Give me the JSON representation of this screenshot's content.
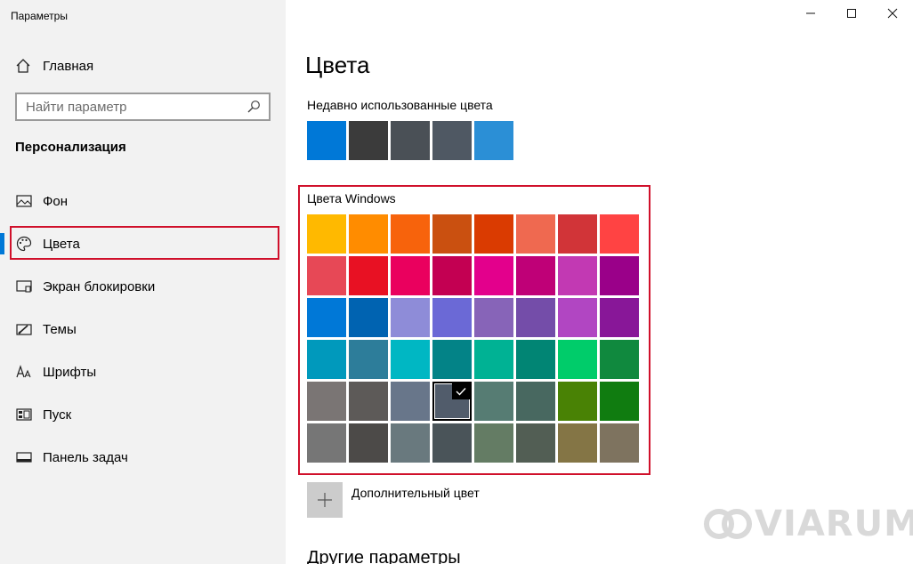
{
  "window": {
    "title": "Параметры"
  },
  "sidebar": {
    "home_label": "Главная",
    "search_placeholder": "Найти параметр",
    "section_title": "Персонализация",
    "items": [
      {
        "label": "Фон",
        "icon": "image-icon"
      },
      {
        "label": "Цвета",
        "icon": "palette-icon",
        "active": true
      },
      {
        "label": "Экран блокировки",
        "icon": "lock-screen-icon"
      },
      {
        "label": "Темы",
        "icon": "themes-icon"
      },
      {
        "label": "Шрифты",
        "icon": "fonts-icon"
      },
      {
        "label": "Пуск",
        "icon": "start-icon"
      },
      {
        "label": "Панель задач",
        "icon": "taskbar-icon"
      }
    ]
  },
  "main": {
    "title": "Цвета",
    "recent_label": "Недавно использованные цвета",
    "recent_colors": [
      "#0078d7",
      "#3b3b3b",
      "#4a5056",
      "#4f5863",
      "#2b8fd6"
    ],
    "windows_colors_label": "Цвета Windows",
    "windows_colors": [
      "#ffb900",
      "#ff8c00",
      "#f7630c",
      "#ca5010",
      "#da3b01",
      "#ef6950",
      "#d13438",
      "#ff4343",
      "#e74856",
      "#e81123",
      "#ea005e",
      "#c30052",
      "#e3008c",
      "#bf0077",
      "#c239b3",
      "#9a0089",
      "#0078d7",
      "#0063b1",
      "#8e8cd8",
      "#6b69d6",
      "#8764b8",
      "#744da9",
      "#b146c2",
      "#881798",
      "#0099bc",
      "#2d7d9a",
      "#00b7c3",
      "#038387",
      "#00b294",
      "#018574",
      "#00cc6a",
      "#10893e",
      "#7a7574",
      "#5d5a58",
      "#68768a",
      "#515c6b",
      "#567c73",
      "#486860",
      "#498205",
      "#107c10",
      "#767676",
      "#4c4a48",
      "#69797e",
      "#4a5459",
      "#647c64",
      "#525e54",
      "#847545",
      "#7e735f"
    ],
    "selected_index": 35,
    "custom_color_label": "Дополнительный цвет",
    "other_params_label": "Другие параметры"
  },
  "watermark": {
    "text": "VIARUM"
  },
  "colors": {
    "accent": "#0078d7",
    "highlight_border": "#d0102b",
    "sidebar_bg": "#f2f2f2"
  }
}
